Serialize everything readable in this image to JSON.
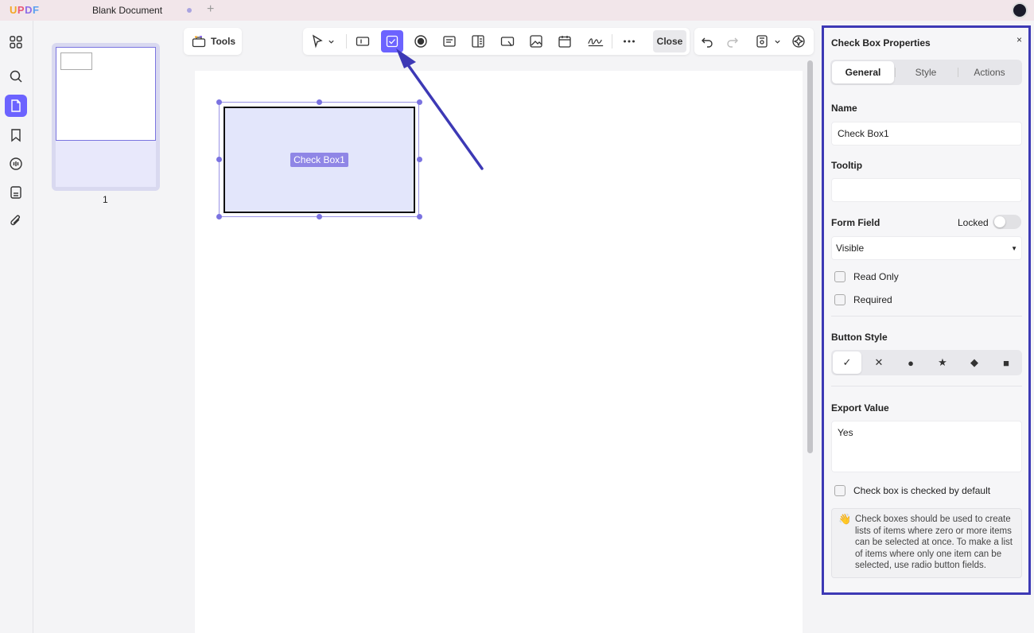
{
  "app": {
    "logo": "UPDF",
    "document_tab": "Blank Document"
  },
  "thumbnails": {
    "page_number": "1"
  },
  "toolbar": {
    "tools_label": "Tools",
    "close_label": "Close"
  },
  "canvas": {
    "field_label": "Check Box1"
  },
  "panel": {
    "title": "Check Box Properties",
    "close": "×",
    "tabs": [
      "General",
      "Style",
      "Actions"
    ],
    "name_label": "Name",
    "name_value": "Check Box1",
    "tooltip_label": "Tooltip",
    "tooltip_value": "",
    "form_field_label": "Form Field",
    "locked_label": "Locked",
    "visibility_value": "Visible",
    "read_only_label": "Read Only",
    "required_label": "Required",
    "button_style_label": "Button Style",
    "button_styles": [
      "✓",
      "✕",
      "●",
      "★",
      "◆",
      "■"
    ],
    "export_value_label": "Export Value",
    "export_value": "Yes",
    "default_checked_label": "Check box is checked by default",
    "info_icon": "👋",
    "info_text": "Check boxes should be used to create lists of items where zero or more items can be selected at once. To make a list of items where only one item can be selected, use radio button fields."
  },
  "colors": {
    "accent": "#6c63ff",
    "panel_border": "#3d39b5",
    "arrow": "#3d39b5"
  }
}
